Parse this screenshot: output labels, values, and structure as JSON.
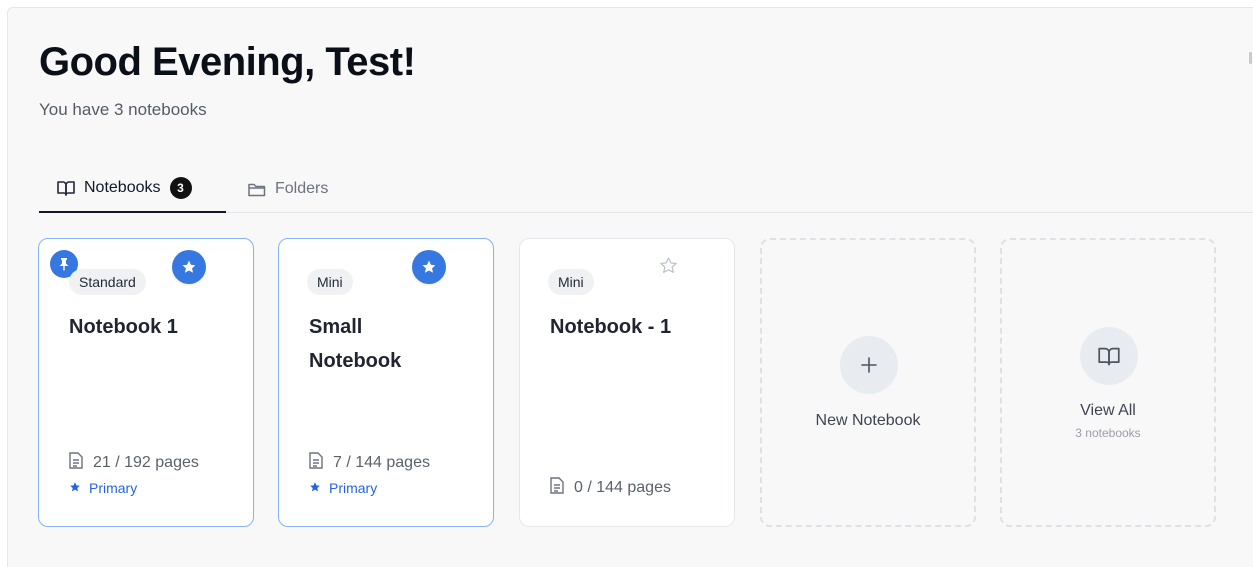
{
  "header": {
    "greeting": "Good Evening, Test!",
    "subtitle": "You have 3 notebooks"
  },
  "tabs": [
    {
      "label": "Notebooks",
      "count": "3",
      "icon": "book-open-icon",
      "active": true
    },
    {
      "label": "Folders",
      "icon": "folder-icon",
      "active": false
    }
  ],
  "notebooks": [
    {
      "type": "Standard",
      "title": "Notebook 1",
      "pages": "21 / 192 pages",
      "primary_label": "Primary",
      "pinned": true,
      "starred": true,
      "selected": true
    },
    {
      "type": "Mini",
      "title": "Small Notebook",
      "pages": "7 / 144 pages",
      "primary_label": "Primary",
      "pinned": false,
      "starred": true,
      "selected": true
    },
    {
      "type": "Mini",
      "title": "Notebook - 1",
      "pages": "0 / 144 pages",
      "pinned": false,
      "starred": false,
      "selected": false
    }
  ],
  "new_notebook": {
    "label": "New Notebook",
    "icon": "plus-icon"
  },
  "view_all": {
    "label": "View All",
    "sublabel": "3 notebooks",
    "icon": "book-open-icon"
  },
  "colors": {
    "accent": "#3777e0",
    "primary_text": "#2563eb",
    "selected_border": "#84b3f5",
    "background": "#f8f8f9"
  }
}
